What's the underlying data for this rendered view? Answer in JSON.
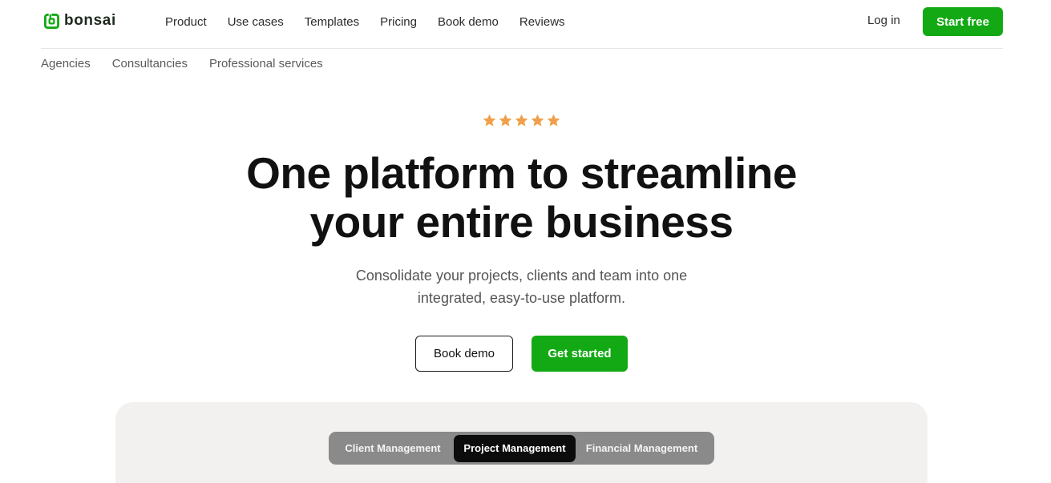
{
  "brand": {
    "name": "bonsai",
    "accent": "#13a914"
  },
  "nav": {
    "items": [
      "Product",
      "Use cases",
      "Templates",
      "Pricing",
      "Book demo",
      "Reviews"
    ],
    "login": "Log in",
    "start_free": "Start free"
  },
  "subnav": {
    "items": [
      "Agencies",
      "Consultancies",
      "Professional services"
    ]
  },
  "hero": {
    "rating": 5,
    "rating_color": "#f0a04b",
    "headline": [
      "One platform to streamline",
      "your entire business"
    ],
    "subtext": [
      "Consolidate your projects, clients and team into one",
      "integrated, easy-to-use platform."
    ],
    "book_demo": "Book demo",
    "get_started": "Get started"
  },
  "preview": {
    "tabs": [
      "Client Management",
      "Project Management",
      "Financial Management"
    ],
    "active_tab": "Project Management"
  }
}
